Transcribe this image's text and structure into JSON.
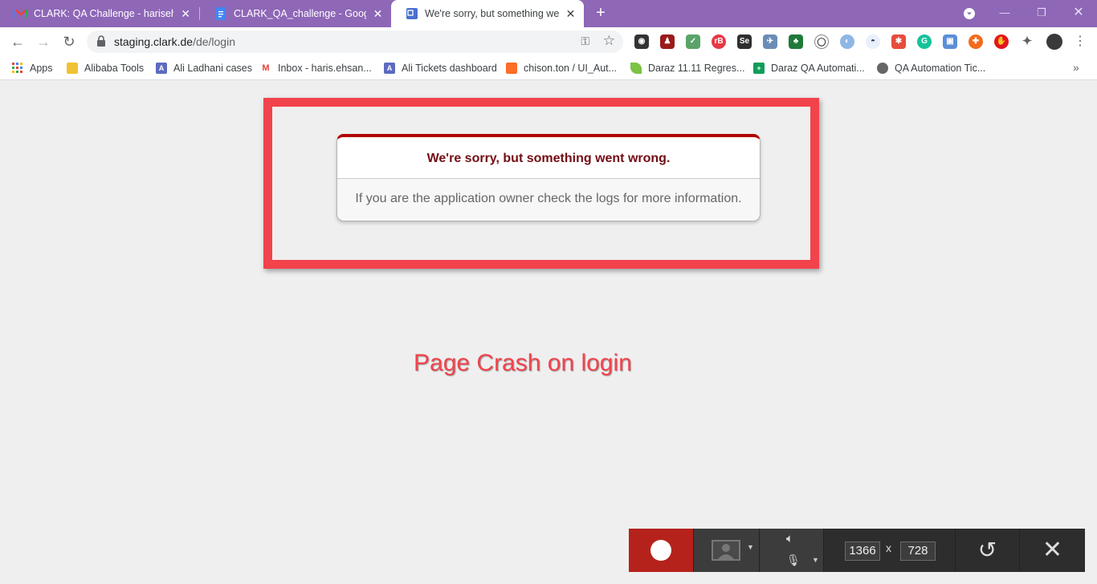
{
  "tabs": [
    {
      "title": "CLARK: QA Challenge - harisehsan",
      "icon": "gmail-icon",
      "active": false
    },
    {
      "title": "CLARK_QA_challenge - Google Docs",
      "icon": "google-docs-icon",
      "active": false
    },
    {
      "title": "We're sorry, but something went wrong",
      "icon": "page-icon",
      "active": true
    }
  ],
  "toolbar": {
    "url_host": "staging.clark.de",
    "url_path": "/de/login"
  },
  "bookmarks": [
    {
      "label": "Apps",
      "icon": "apps-grid-icon"
    },
    {
      "label": "Alibaba Tools",
      "icon": "folder-icon"
    },
    {
      "label": "Ali Ladhani cases",
      "icon": "a-letter-icon"
    },
    {
      "label": "Inbox - haris.ehsan...",
      "icon": "gmail-icon"
    },
    {
      "label": "Ali Tickets dashboard",
      "icon": "a-letter-icon"
    },
    {
      "label": "chison.ton / UI_Aut...",
      "icon": "gitlab-icon"
    },
    {
      "label": "Daraz 11.11 Regres...",
      "icon": "leaf-icon"
    },
    {
      "label": "Daraz QA Automati...",
      "icon": "sheets-icon"
    },
    {
      "label": "QA Automation Tic...",
      "icon": "globe-icon"
    }
  ],
  "error": {
    "heading": "We're sorry, but something went wrong.",
    "message": "If you are the application owner check the logs for more information."
  },
  "annotation": "Page Crash on login",
  "recorder": {
    "width": "1366",
    "height": "728",
    "separator": "x"
  },
  "colors": {
    "tabstrip": "#8e67b7",
    "highlight": "#f2434c",
    "error_heading": "#730e15",
    "record": "#b5221b"
  }
}
